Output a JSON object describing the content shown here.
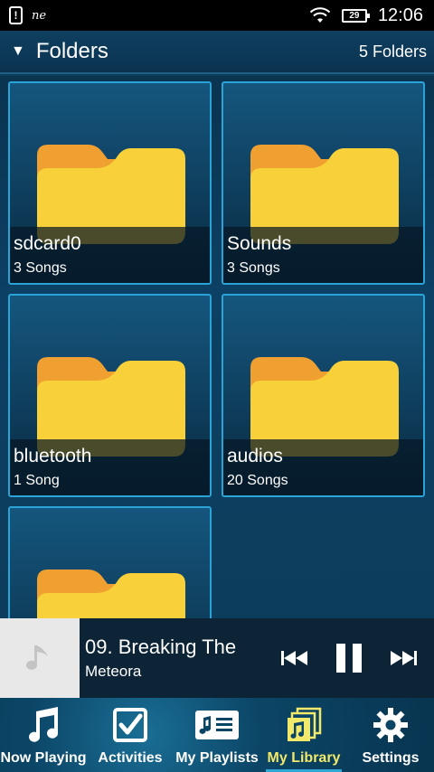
{
  "status_bar": {
    "carrier": "ne",
    "notification": "!",
    "battery": "29",
    "time": "12:06"
  },
  "header": {
    "title": "Folders",
    "count": "5 Folders"
  },
  "folders": [
    {
      "name": "sdcard0",
      "count": "3 Songs"
    },
    {
      "name": "Sounds",
      "count": "3 Songs"
    },
    {
      "name": "bluetooth",
      "count": "1 Song"
    },
    {
      "name": "audios",
      "count": "20 Songs"
    },
    {
      "name": "",
      "count": ""
    }
  ],
  "player": {
    "title": "09. Breaking The",
    "artist": "Meteora"
  },
  "nav": {
    "items": [
      {
        "label": "Now Playing",
        "icon": "music-note-icon"
      },
      {
        "label": "Activities",
        "icon": "checkbox-icon"
      },
      {
        "label": "My Playlists",
        "icon": "playlist-icon"
      },
      {
        "label": "My Library",
        "icon": "library-icon",
        "active": true
      },
      {
        "label": "Settings",
        "icon": "gear-icon"
      }
    ]
  },
  "colors": {
    "accent": "#2aa3d6",
    "active_label": "#f2e86a",
    "folder_front": "#f7d03a",
    "folder_back": "#f0a030"
  }
}
